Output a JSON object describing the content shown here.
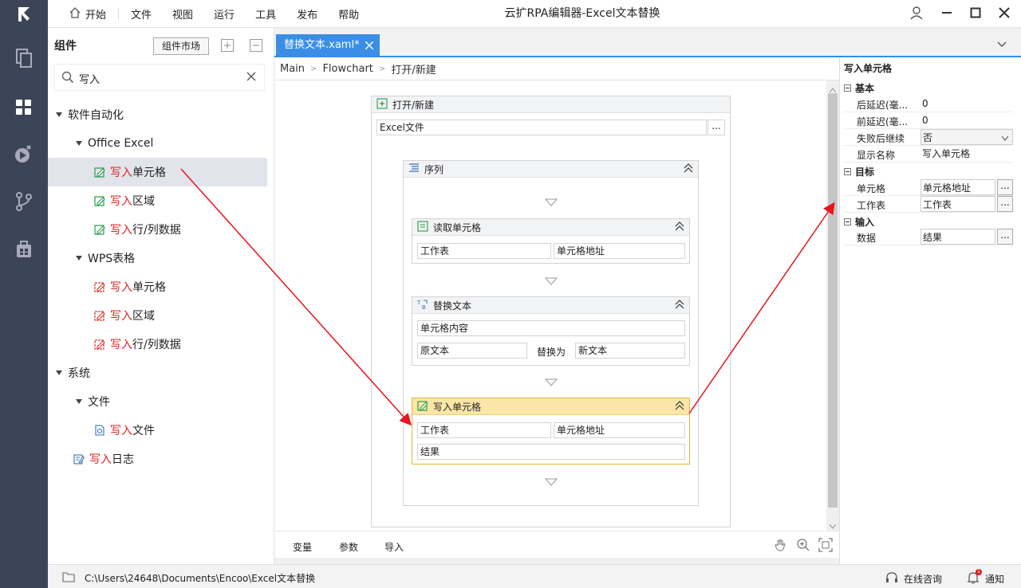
{
  "app": {
    "title": "云扩RPA编辑器-Excel文本替换",
    "menu": [
      "开始",
      "文件",
      "视图",
      "运行",
      "工具",
      "发布",
      "帮助"
    ]
  },
  "rail_icons": [
    "logo-icon",
    "files-icon",
    "components-icon",
    "debug-icon",
    "branch-icon",
    "package-icon"
  ],
  "components_panel": {
    "title": "组件",
    "market_label": "组件市场",
    "search": {
      "value": "写入",
      "placeholder": ""
    },
    "tree": [
      {
        "label": "软件自动化",
        "type": "group"
      },
      {
        "label": "Office Excel",
        "type": "group"
      },
      {
        "hl": "写入",
        "rest": "单元格",
        "type": "item",
        "selected": true
      },
      {
        "hl": "写入",
        "rest": "区域",
        "type": "item"
      },
      {
        "hl": "写入",
        "rest": "行/列数据",
        "type": "item"
      },
      {
        "label": "WPS表格",
        "type": "group"
      },
      {
        "hl": "写入",
        "rest": "单元格",
        "type": "item"
      },
      {
        "hl": "写入",
        "rest": "区域",
        "type": "item"
      },
      {
        "hl": "写入",
        "rest": "行/列数据",
        "type": "item"
      },
      {
        "label": "系统",
        "type": "group"
      },
      {
        "label": "文件",
        "type": "group"
      },
      {
        "hl": "写入",
        "rest": "文件",
        "type": "item"
      },
      {
        "hl": "写入",
        "rest": "日志",
        "type": "item"
      }
    ]
  },
  "tab": {
    "label": "替换文本.xaml*"
  },
  "breadcrumb": [
    "Main",
    "Flowchart",
    "打开/新建"
  ],
  "workflow": {
    "open": {
      "title": "打开/新建",
      "field": "Excel文件",
      "btn": "..."
    },
    "sequence": {
      "title": "序列"
    },
    "read_cell": {
      "title": "读取单元格",
      "sheet": "工作表",
      "address": "单元格地址"
    },
    "replace": {
      "title": "替换文本",
      "content": "单元格内容",
      "original": "原文本",
      "replace_with": "替换为",
      "new_text": "新文本"
    },
    "write_cell": {
      "title": "写入单元格",
      "sheet": "工作表",
      "address": "单元格地址",
      "data": "结果"
    }
  },
  "bottom_tabs": [
    "变量",
    "参数",
    "导入"
  ],
  "properties": {
    "title": "写入单元格",
    "sections": {
      "basic": "基本",
      "target": "目标",
      "input": "输入"
    },
    "rows": {
      "after_delay": {
        "label": "后延迟(毫...",
        "value": "0"
      },
      "before_delay": {
        "label": "前延迟(毫...",
        "value": "0"
      },
      "continue_on_error": {
        "label": "失败后继续",
        "value": "否"
      },
      "display_name": {
        "label": "显示名称",
        "value": "写入单元格"
      },
      "cell": {
        "label": "单元格",
        "value": "单元格地址"
      },
      "sheet": {
        "label": "工作表",
        "value": "工作表"
      },
      "data": {
        "label": "数据",
        "value": "结果"
      }
    },
    "ellipsis": "..."
  },
  "status": {
    "path": "C:\\Users\\24648\\Documents\\Encoo\\Excel文本替换",
    "consult": "在线咨询",
    "notify": "通知",
    "notify_count": "1"
  },
  "colors": {
    "accent": "#3a8ee6",
    "highlight": "#e02020",
    "selected_card": "#fbe6a8",
    "rail": "#3c4557"
  }
}
